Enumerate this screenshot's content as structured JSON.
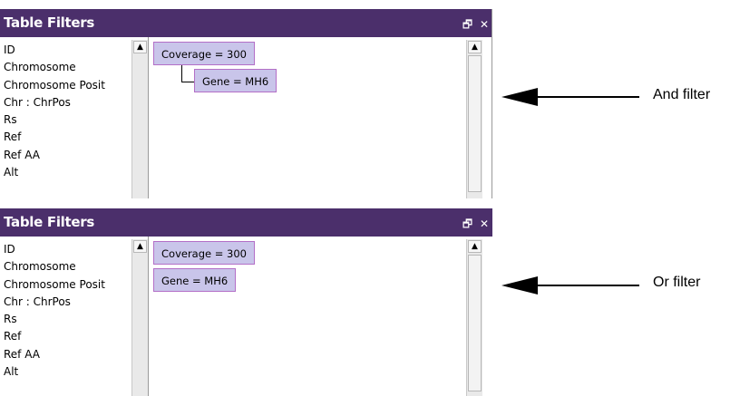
{
  "panels": [
    {
      "title": "Table Filters",
      "fields": [
        "ID",
        "Chromosome",
        "Chromosome Posit",
        "Chr : ChrPos",
        "Rs",
        "Ref",
        "Ref AA",
        "Alt"
      ],
      "filters": [
        "Coverage = 300",
        "Gene = MH6"
      ],
      "annotation": "And filter"
    },
    {
      "title": "Table Filters",
      "fields": [
        "ID",
        "Chromosome",
        "Chromosome Posit",
        "Chr : ChrPos",
        "Rs",
        "Ref",
        "Ref AA",
        "Alt"
      ],
      "filters": [
        "Coverage = 300",
        "Gene = MH6"
      ],
      "annotation": "Or filter"
    }
  ],
  "icons": {
    "restore": "restore-icon",
    "close": "close-icon",
    "scroll_up": "scroll-up-arrow-icon",
    "pointer": "left-arrow-icon"
  },
  "colors": {
    "titlebar": "#4b2f6b",
    "chip_fill": "#c9c5ea",
    "chip_border": "#b36fc7"
  }
}
